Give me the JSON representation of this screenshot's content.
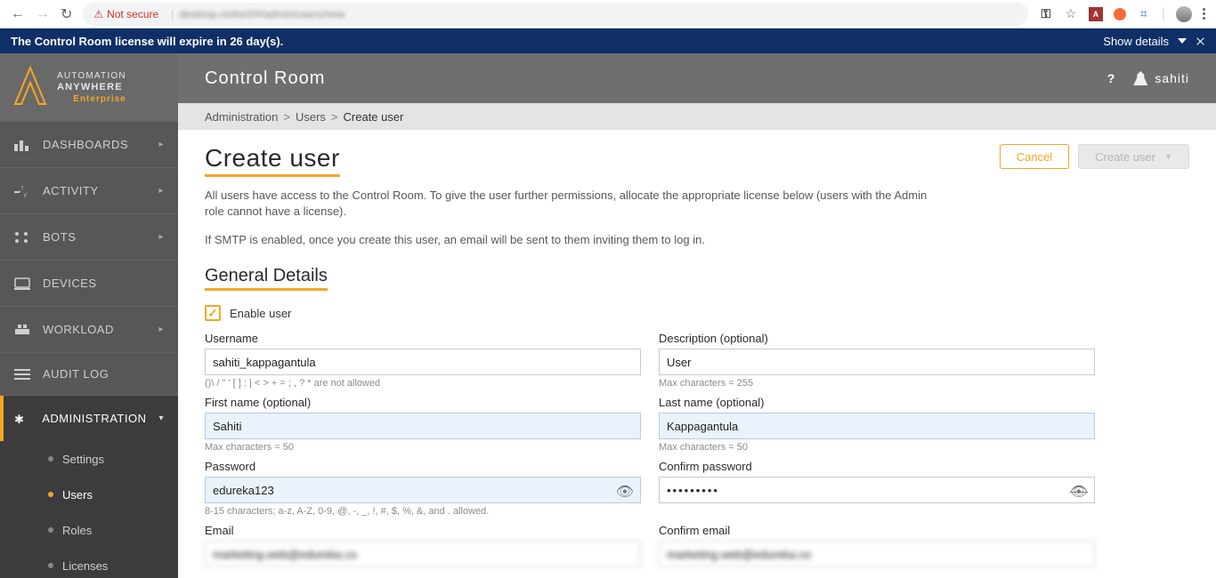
{
  "browser": {
    "not_secure_label": "Not secure",
    "url_obscured": "desktop-noihe0/#/admin/users/new"
  },
  "license_banner": {
    "text": "The Control Room license will expire in 26 day(s).",
    "show_details": "Show details"
  },
  "brand": {
    "line1": "AUTOMATION",
    "line2": "ANYWHERE",
    "line3": "Enterprise"
  },
  "sidebar": {
    "items": [
      {
        "key": "dashboards",
        "label": "DASHBOARDS"
      },
      {
        "key": "activity",
        "label": "ACTIVITY"
      },
      {
        "key": "bots",
        "label": "BOTS"
      },
      {
        "key": "devices",
        "label": "DEVICES"
      },
      {
        "key": "workload",
        "label": "WORKLOAD"
      },
      {
        "key": "auditlog",
        "label": "AUDIT LOG"
      },
      {
        "key": "administration",
        "label": "ADMINISTRATION"
      }
    ],
    "administration_sub": [
      {
        "key": "settings",
        "label": "Settings"
      },
      {
        "key": "users",
        "label": "Users",
        "selected": true
      },
      {
        "key": "roles",
        "label": "Roles"
      },
      {
        "key": "licenses",
        "label": "Licenses"
      }
    ]
  },
  "header": {
    "title": "Control Room",
    "help": "?",
    "username": "sahiti"
  },
  "breadcrumbs": {
    "a": "Administration",
    "b": "Users",
    "c": "Create user"
  },
  "page": {
    "title": "Create user",
    "cancel_label": "Cancel",
    "create_label": "Create user",
    "intro1": "All users have access to the Control Room. To give the user further permissions, allocate the appropriate license below (users with the Admin role cannot have a license).",
    "intro2": "If SMTP is enabled, once you create this user, an email will be sent to them inviting them to log in.",
    "section": "General Details",
    "enable_user": "Enable user",
    "fields": {
      "username": {
        "label": "Username",
        "value": "sahiti_kappagantula",
        "hint": "()\\ / \" ' [ ] : | < > + = ; , ? *   are not allowed"
      },
      "description": {
        "label": "Description (optional)",
        "value": "User",
        "hint": "Max characters = 255"
      },
      "first_name": {
        "label": "First name (optional)",
        "value": "Sahiti",
        "hint": "Max characters = 50"
      },
      "last_name": {
        "label": "Last name (optional)",
        "value": "Kappagantula",
        "hint": "Max characters = 50"
      },
      "password": {
        "label": "Password",
        "value": "edureka123",
        "hint": "8-15 characters; a-z, A-Z, 0-9, @, -, _, !, #, $, %, &, and . allowed."
      },
      "confirm_pw": {
        "label": "Confirm password",
        "value": "•••••••••"
      },
      "email": {
        "label": "Email",
        "value": "marketing.web@edureka.co"
      },
      "confirm_em": {
        "label": "Confirm email",
        "value": "marketing.web@edureka.co"
      }
    }
  }
}
